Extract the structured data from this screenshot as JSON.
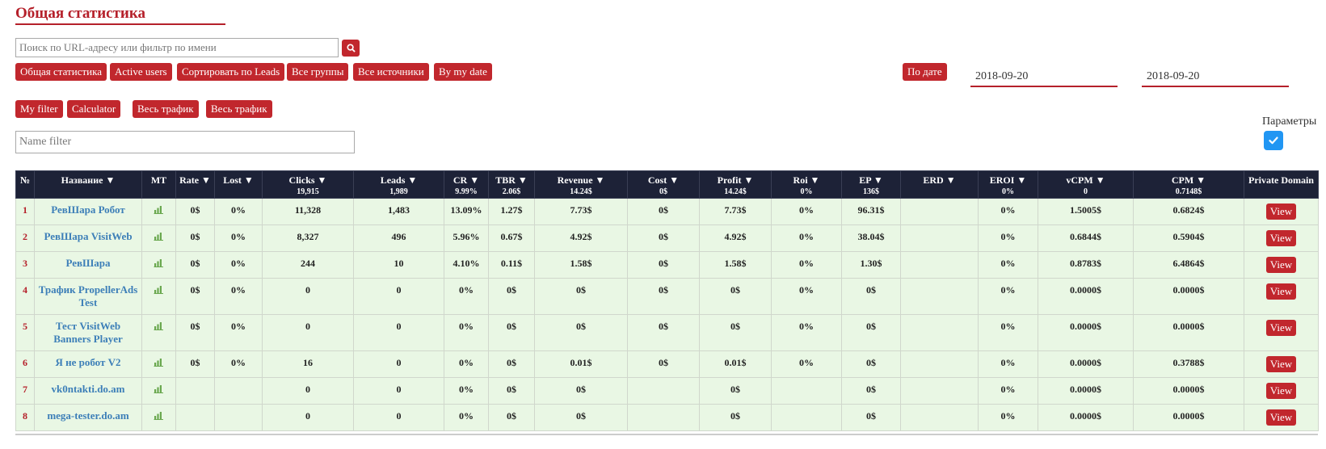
{
  "page": {
    "title": "Общая статистика"
  },
  "search": {
    "placeholder": "Поиск по URL-адресу или фильтр по имени",
    "icon": "search-icon"
  },
  "toolbar": {
    "buttons": [
      "Общая статистика",
      "Active users",
      "Сортировать по Leads",
      "Все группы",
      "Все источники",
      "By my date"
    ],
    "date_button": "По дате",
    "date_from": "2018-09-20",
    "date_to": "2018-09-20"
  },
  "filters": {
    "buttons": [
      "My filter",
      "Calculator",
      "Весь трафик",
      "Весь трафик"
    ],
    "name_filter_placeholder": "Name filter"
  },
  "params": {
    "label": "Параметры",
    "checked": true
  },
  "colors": {
    "accent": "#c1272d",
    "header_bg": "#1d2237",
    "row_bg": "#e9f7e4",
    "link": "#3d7fb8",
    "check": "#2196f3"
  },
  "table": {
    "headers": [
      {
        "label": "№",
        "sub": ""
      },
      {
        "label": "Название ▼",
        "sub": ""
      },
      {
        "label": "MT",
        "sub": ""
      },
      {
        "label": "Rate ▼",
        "sub": ""
      },
      {
        "label": "Lost ▼",
        "sub": ""
      },
      {
        "label": "Clicks ▼",
        "sub": "19,915"
      },
      {
        "label": "Leads ▼",
        "sub": "1,989"
      },
      {
        "label": "CR ▼",
        "sub": "9.99%"
      },
      {
        "label": "TBR ▼",
        "sub": "2.06$"
      },
      {
        "label": "Revenue ▼",
        "sub": "14.24$"
      },
      {
        "label": "Cost ▼",
        "sub": "0$"
      },
      {
        "label": "Profit ▼",
        "sub": "14.24$"
      },
      {
        "label": "Roi ▼",
        "sub": "0%"
      },
      {
        "label": "EP ▼",
        "sub": "136$"
      },
      {
        "label": "ERD ▼",
        "sub": ""
      },
      {
        "label": "EROI ▼",
        "sub": "0%"
      },
      {
        "label": "vCPM ▼",
        "sub": "0"
      },
      {
        "label": "CPM ▼",
        "sub": "0.7148$"
      },
      {
        "label": "Private Domain",
        "sub": ""
      }
    ],
    "view_label": "View",
    "rows": [
      {
        "num": "1",
        "name": "РевШара Робот",
        "rate": "0$",
        "lost": "0%",
        "clicks": "11,328",
        "leads": "1,483",
        "cr": "13.09%",
        "tbr": "1.27$",
        "revenue": "7.73$",
        "cost": "0$",
        "profit": "7.73$",
        "roi": "0%",
        "ep": "96.31$",
        "erd": "",
        "eroi": "0%",
        "vcpm": "1.5005$",
        "cpm": "0.6824$"
      },
      {
        "num": "2",
        "name": "РевШара VisitWeb",
        "rate": "0$",
        "lost": "0%",
        "clicks": "8,327",
        "leads": "496",
        "cr": "5.96%",
        "tbr": "0.67$",
        "revenue": "4.92$",
        "cost": "0$",
        "profit": "4.92$",
        "roi": "0%",
        "ep": "38.04$",
        "erd": "",
        "eroi": "0%",
        "vcpm": "0.6844$",
        "cpm": "0.5904$"
      },
      {
        "num": "3",
        "name": "РевШара",
        "rate": "0$",
        "lost": "0%",
        "clicks": "244",
        "leads": "10",
        "cr": "4.10%",
        "tbr": "0.11$",
        "revenue": "1.58$",
        "cost": "0$",
        "profit": "1.58$",
        "roi": "0%",
        "ep": "1.30$",
        "erd": "",
        "eroi": "0%",
        "vcpm": "0.8783$",
        "cpm": "6.4864$"
      },
      {
        "num": "4",
        "name": "Трафик PropellerAds Test",
        "rate": "0$",
        "lost": "0%",
        "clicks": "0",
        "leads": "0",
        "cr": "0%",
        "tbr": "0$",
        "revenue": "0$",
        "cost": "0$",
        "profit": "0$",
        "roi": "0%",
        "ep": "0$",
        "erd": "",
        "eroi": "0%",
        "vcpm": "0.0000$",
        "cpm": "0.0000$"
      },
      {
        "num": "5",
        "name": "Тест VisitWeb Banners Player",
        "rate": "0$",
        "lost": "0%",
        "clicks": "0",
        "leads": "0",
        "cr": "0%",
        "tbr": "0$",
        "revenue": "0$",
        "cost": "0$",
        "profit": "0$",
        "roi": "0%",
        "ep": "0$",
        "erd": "",
        "eroi": "0%",
        "vcpm": "0.0000$",
        "cpm": "0.0000$"
      },
      {
        "num": "6",
        "name": "Я не робот V2",
        "rate": "0$",
        "lost": "0%",
        "clicks": "16",
        "leads": "0",
        "cr": "0%",
        "tbr": "0$",
        "revenue": "0.01$",
        "cost": "0$",
        "profit": "0.01$",
        "roi": "0%",
        "ep": "0$",
        "erd": "",
        "eroi": "0%",
        "vcpm": "0.0000$",
        "cpm": "0.3788$"
      },
      {
        "num": "7",
        "name": "vk0ntakti.do.am",
        "rate": "",
        "lost": "",
        "clicks": "0",
        "leads": "0",
        "cr": "0%",
        "tbr": "0$",
        "revenue": "0$",
        "cost": "",
        "profit": "0$",
        "roi": "",
        "ep": "0$",
        "erd": "",
        "eroi": "0%",
        "vcpm": "0.0000$",
        "cpm": "0.0000$"
      },
      {
        "num": "8",
        "name": "mega-tester.do.am",
        "rate": "",
        "lost": "",
        "clicks": "0",
        "leads": "0",
        "cr": "0%",
        "tbr": "0$",
        "revenue": "0$",
        "cost": "",
        "profit": "0$",
        "roi": "",
        "ep": "0$",
        "erd": "",
        "eroi": "0%",
        "vcpm": "0.0000$",
        "cpm": "0.0000$"
      }
    ]
  }
}
